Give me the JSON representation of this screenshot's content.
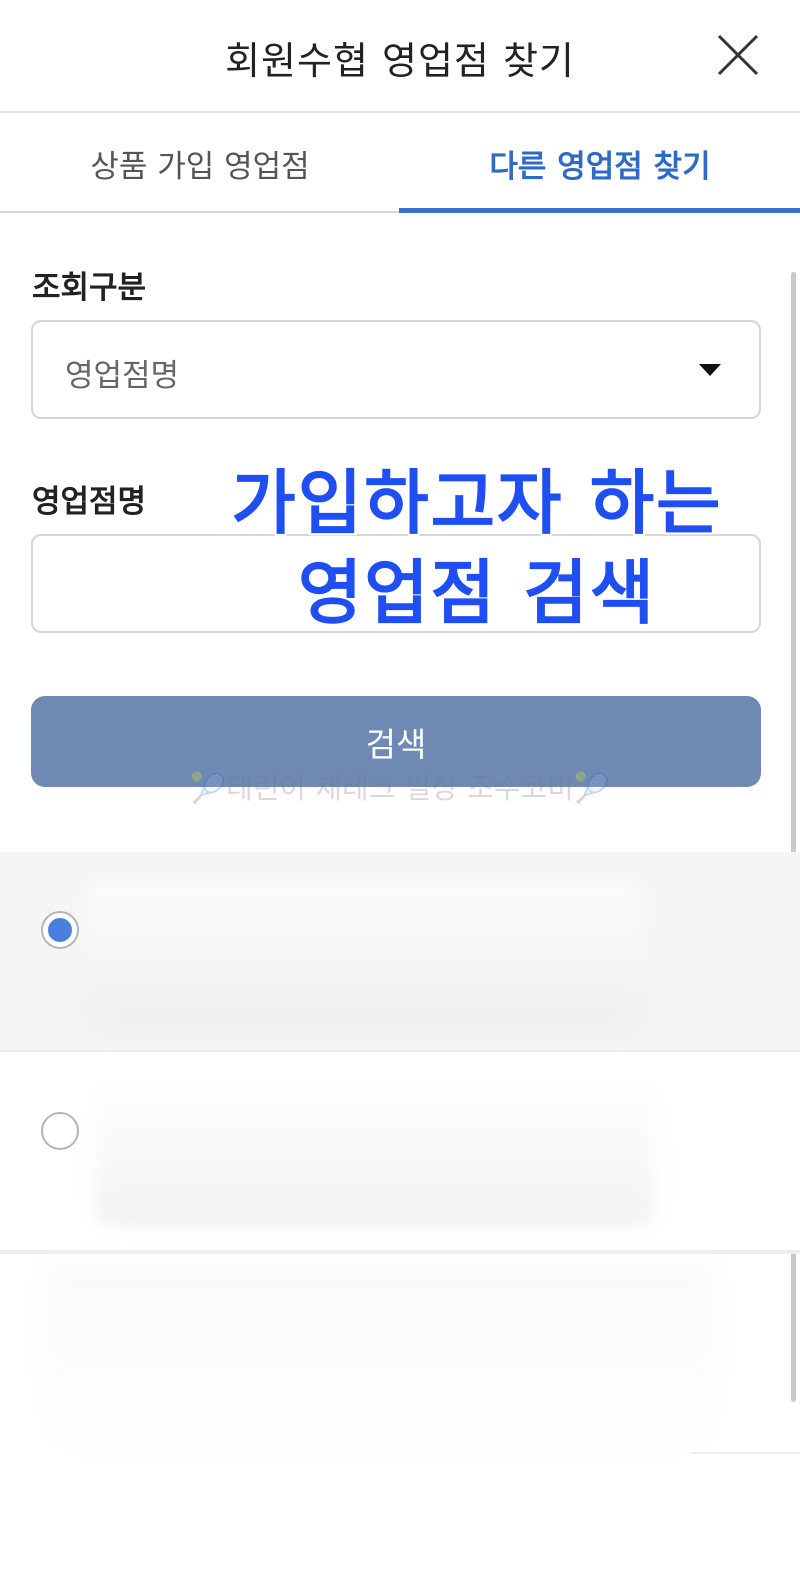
{
  "header": {
    "title": "회원수협 영업점 찾기",
    "close_icon": "close-icon"
  },
  "tabs": [
    {
      "label": "상품 가입 영업점",
      "active": false
    },
    {
      "label": "다른 영업점 찾기",
      "active": true
    }
  ],
  "form": {
    "category_label": "조회구분",
    "category_value": "영업점명",
    "branch_label": "영업점명",
    "branch_input_value": "",
    "search_button_label": "검색"
  },
  "overlay": {
    "line1": "가입하고자 하는",
    "line2": "영업점 검색"
  },
  "watermark": "🎾테린이 재테크 일상 조수코비🎾",
  "results": [
    {
      "selected": true
    },
    {
      "selected": false
    }
  ],
  "colors": {
    "accent": "#2f6bc4",
    "search_button": "#6f89b5",
    "overlay_text": "#1f4ff2",
    "radio_checked": "#4a7fdf"
  }
}
